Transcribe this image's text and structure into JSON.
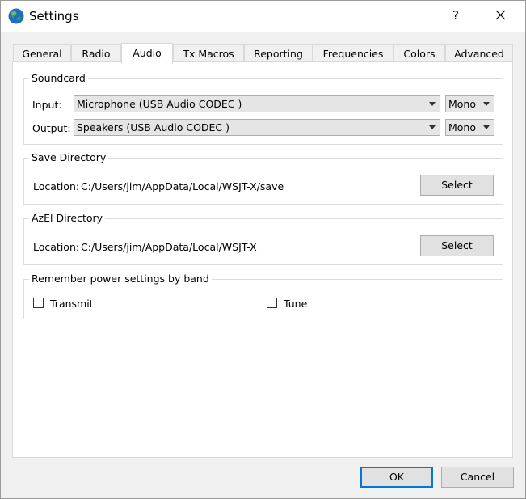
{
  "window": {
    "title": "Settings",
    "help_glyph": "?"
  },
  "tabs": [
    "General",
    "Radio",
    "Audio",
    "Tx Macros",
    "Reporting",
    "Frequencies",
    "Colors",
    "Advanced"
  ],
  "active_tab": "Audio",
  "soundcard": {
    "title": "Soundcard",
    "input_label": "Input:",
    "input_device": "Microphone (USB Audio CODEC )",
    "input_channel": "Mono",
    "output_label": "Output:",
    "output_device": "Speakers (USB Audio CODEC )",
    "output_channel": "Mono"
  },
  "save_directory": {
    "title": "Save Directory",
    "location_label": "Location:",
    "path": "C:/Users/jim/AppData/Local/WSJT-X/save",
    "select_label": "Select"
  },
  "azel_directory": {
    "title": "AzEl Directory",
    "location_label": "Location:",
    "path": "C:/Users/jim/AppData/Local/WSJT-X",
    "select_label": "Select"
  },
  "power": {
    "title": "Remember power settings by band",
    "transmit_label": "Transmit",
    "transmit_checked": false,
    "tune_label": "Tune",
    "tune_checked": false
  },
  "footer": {
    "ok_label": "OK",
    "cancel_label": "Cancel"
  },
  "colors": {
    "accent": "#0078d7"
  }
}
